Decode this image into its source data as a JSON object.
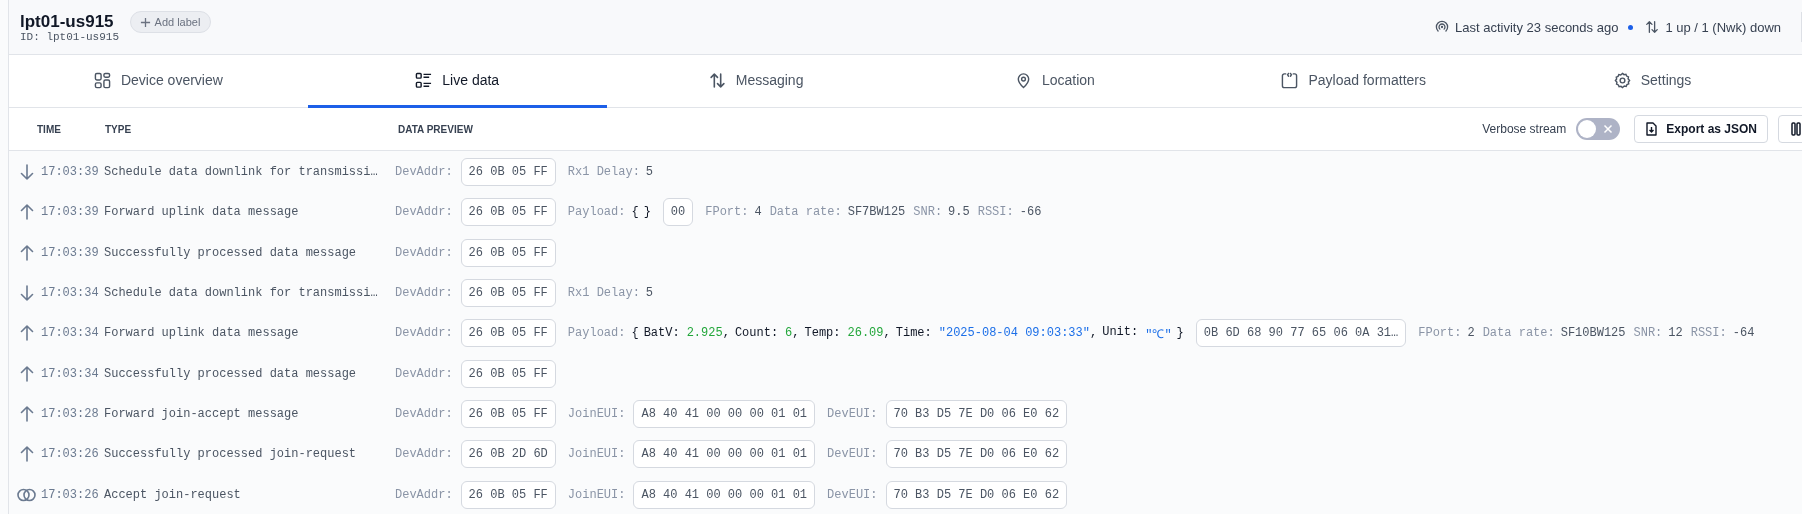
{
  "device": {
    "title": "lpt01-us915",
    "id": "ID: lpt01-us915",
    "add_label": "Add label",
    "last_activity": "Last activity 23 seconds ago",
    "live": true,
    "frame_counts": "1 up / 1 (Nwk) down"
  },
  "tabs": [
    {
      "label": "Device overview",
      "selected": false
    },
    {
      "label": "Live data",
      "selected": true
    },
    {
      "label": "Messaging",
      "selected": false
    },
    {
      "label": "Location",
      "selected": false
    },
    {
      "label": "Payload formatters",
      "selected": false
    },
    {
      "label": "Settings",
      "selected": false
    }
  ],
  "table": {
    "columns": [
      "TIME",
      "TYPE",
      "DATA PREVIEW"
    ],
    "verbose_stream": {
      "label": "Verbose stream",
      "on": false
    },
    "export_button": "Export as JSON",
    "rows": [
      {
        "kind": "downlink",
        "time": "17:03:39",
        "type": "Schedule data downlink for transmissi…",
        "fields": [
          {
            "kind": "chip",
            "label": "DevAddr:",
            "value": "26 0B 05 FF"
          },
          {
            "kind": "pair",
            "label": "Rx1 Delay:",
            "value": "5"
          }
        ]
      },
      {
        "kind": "uplink",
        "time": "17:03:39",
        "type": "Forward uplink data message",
        "fields": [
          {
            "kind": "chip",
            "label": "DevAddr:",
            "value": "26 0B 05 FF"
          },
          {
            "kind": "payload",
            "label": "Payload:",
            "open": "{",
            "close": "}"
          },
          {
            "kind": "chip",
            "value": "00"
          },
          {
            "kind": "pair",
            "label": "FPort:",
            "value": "4"
          },
          {
            "kind": "pair",
            "label": "Data rate:",
            "value": "SF7BW125"
          },
          {
            "kind": "pair",
            "label": "SNR:",
            "value": "9.5"
          },
          {
            "kind": "pair",
            "label": "RSSI:",
            "value": "-66"
          }
        ]
      },
      {
        "kind": "uplink",
        "time": "17:03:39",
        "type": "Successfully processed data message",
        "fields": [
          {
            "kind": "chip",
            "label": "DevAddr:",
            "value": "26 0B 05 FF"
          }
        ]
      },
      {
        "kind": "downlink",
        "time": "17:03:34",
        "type": "Schedule data downlink for transmissi…",
        "fields": [
          {
            "kind": "chip",
            "label": "DevAddr:",
            "value": "26 0B 05 FF"
          },
          {
            "kind": "pair",
            "label": "Rx1 Delay:",
            "value": "5"
          }
        ]
      },
      {
        "kind": "uplink",
        "time": "17:03:34",
        "type": "Forward uplink data message",
        "fields": [
          {
            "kind": "chip",
            "label": "DevAddr:",
            "value": "26 0B 05 FF"
          },
          {
            "kind": "payload",
            "label": "Payload:",
            "open": "{",
            "close": "}",
            "entries": [
              {
                "key": "BatV:",
                "value": "2.925",
                "kind": "number",
                "sep": ","
              },
              {
                "key": "Count:",
                "value": "6",
                "kind": "number",
                "sep": ","
              },
              {
                "key": "Temp:",
                "value": "26.09",
                "kind": "number",
                "sep": ","
              },
              {
                "key": "Time:",
                "value": "\"2025-08-04 09:03:33\"",
                "kind": "string",
                "sep": ","
              },
              {
                "key": "Unit:",
                "value": "\"℃\"",
                "kind": "string"
              }
            ]
          },
          {
            "kind": "chip",
            "value": "0B 6D 68 90 77 65 06 0A 31…"
          },
          {
            "kind": "pair",
            "label": "FPort:",
            "value": "2"
          },
          {
            "kind": "pair",
            "label": "Data rate:",
            "value": "SF10BW125"
          },
          {
            "kind": "pair",
            "label": "SNR:",
            "value": "12"
          },
          {
            "kind": "pair",
            "label": "RSSI:",
            "value": "-64"
          }
        ]
      },
      {
        "kind": "uplink",
        "time": "17:03:34",
        "type": "Successfully processed data message",
        "fields": [
          {
            "kind": "chip",
            "label": "DevAddr:",
            "value": "26 0B 05 FF"
          }
        ]
      },
      {
        "kind": "uplink",
        "time": "17:03:28",
        "type": "Forward join-accept message",
        "fields": [
          {
            "kind": "chip",
            "label": "DevAddr:",
            "value": "26 0B 05 FF"
          },
          {
            "kind": "chip",
            "label": "JoinEUI:",
            "value": "A8 40 41 00 00 00 01 01"
          },
          {
            "kind": "chip",
            "label": "DevEUI:",
            "value": "70 B3 D5 7E D0 06 E0 62"
          }
        ]
      },
      {
        "kind": "uplink",
        "time": "17:03:26",
        "type": "Successfully processed join-request",
        "fields": [
          {
            "kind": "chip",
            "label": "DevAddr:",
            "value": "26 0B 2D 6D"
          },
          {
            "kind": "chip",
            "label": "JoinEUI:",
            "value": "A8 40 41 00 00 00 01 01"
          },
          {
            "kind": "chip",
            "label": "DevEUI:",
            "value": "70 B3 D5 7E D0 06 E0 62"
          }
        ]
      },
      {
        "kind": "join",
        "time": "17:03:26",
        "type": "Accept join-request",
        "fields": [
          {
            "kind": "chip",
            "label": "DevAddr:",
            "value": "26 0B 05 FF"
          },
          {
            "kind": "chip",
            "label": "JoinEUI:",
            "value": "A8 40 41 00 00 00 01 01"
          },
          {
            "kind": "chip",
            "label": "DevEUI:",
            "value": "70 B3 D5 7E D0 06 E0 62"
          }
        ]
      }
    ]
  }
}
